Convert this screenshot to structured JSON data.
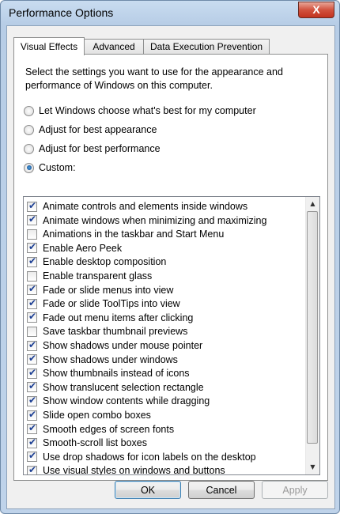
{
  "window": {
    "title": "Performance Options",
    "close_glyph": "X"
  },
  "tabs": [
    {
      "label": "Visual Effects",
      "active": true
    },
    {
      "label": "Advanced",
      "active": false
    },
    {
      "label": "Data Execution Prevention",
      "active": false
    }
  ],
  "description": "Select the settings you want to use for the appearance and performance of Windows on this computer.",
  "radios": [
    {
      "label": "Let Windows choose what's best for my computer",
      "checked": false
    },
    {
      "label": "Adjust for best appearance",
      "checked": false
    },
    {
      "label": "Adjust for best performance",
      "checked": false
    },
    {
      "label": "Custom:",
      "checked": true
    }
  ],
  "effects": [
    {
      "label": "Animate controls and elements inside windows",
      "checked": true
    },
    {
      "label": "Animate windows when minimizing and maximizing",
      "checked": true
    },
    {
      "label": "Animations in the taskbar and Start Menu",
      "checked": false
    },
    {
      "label": "Enable Aero Peek",
      "checked": true
    },
    {
      "label": "Enable desktop composition",
      "checked": true
    },
    {
      "label": "Enable transparent glass",
      "checked": false
    },
    {
      "label": "Fade or slide menus into view",
      "checked": true
    },
    {
      "label": "Fade or slide ToolTips into view",
      "checked": true
    },
    {
      "label": "Fade out menu items after clicking",
      "checked": true
    },
    {
      "label": "Save taskbar thumbnail previews",
      "checked": false
    },
    {
      "label": "Show shadows under mouse pointer",
      "checked": true
    },
    {
      "label": "Show shadows under windows",
      "checked": true
    },
    {
      "label": "Show thumbnails instead of icons",
      "checked": true
    },
    {
      "label": "Show translucent selection rectangle",
      "checked": true
    },
    {
      "label": "Show window contents while dragging",
      "checked": true
    },
    {
      "label": "Slide open combo boxes",
      "checked": true
    },
    {
      "label": "Smooth edges of screen fonts",
      "checked": true
    },
    {
      "label": "Smooth-scroll list boxes",
      "checked": true
    },
    {
      "label": "Use drop shadows for icon labels on the desktop",
      "checked": true
    },
    {
      "label": "Use visual styles on windows and buttons",
      "checked": true
    }
  ],
  "scrollbar": {
    "up_glyph": "▲",
    "down_glyph": "▼"
  },
  "buttons": {
    "ok": "OK",
    "cancel": "Cancel",
    "apply": "Apply"
  },
  "colors": {
    "accent": "#3c7fb1",
    "check": "#1c3f94",
    "close": "#c2331f"
  }
}
